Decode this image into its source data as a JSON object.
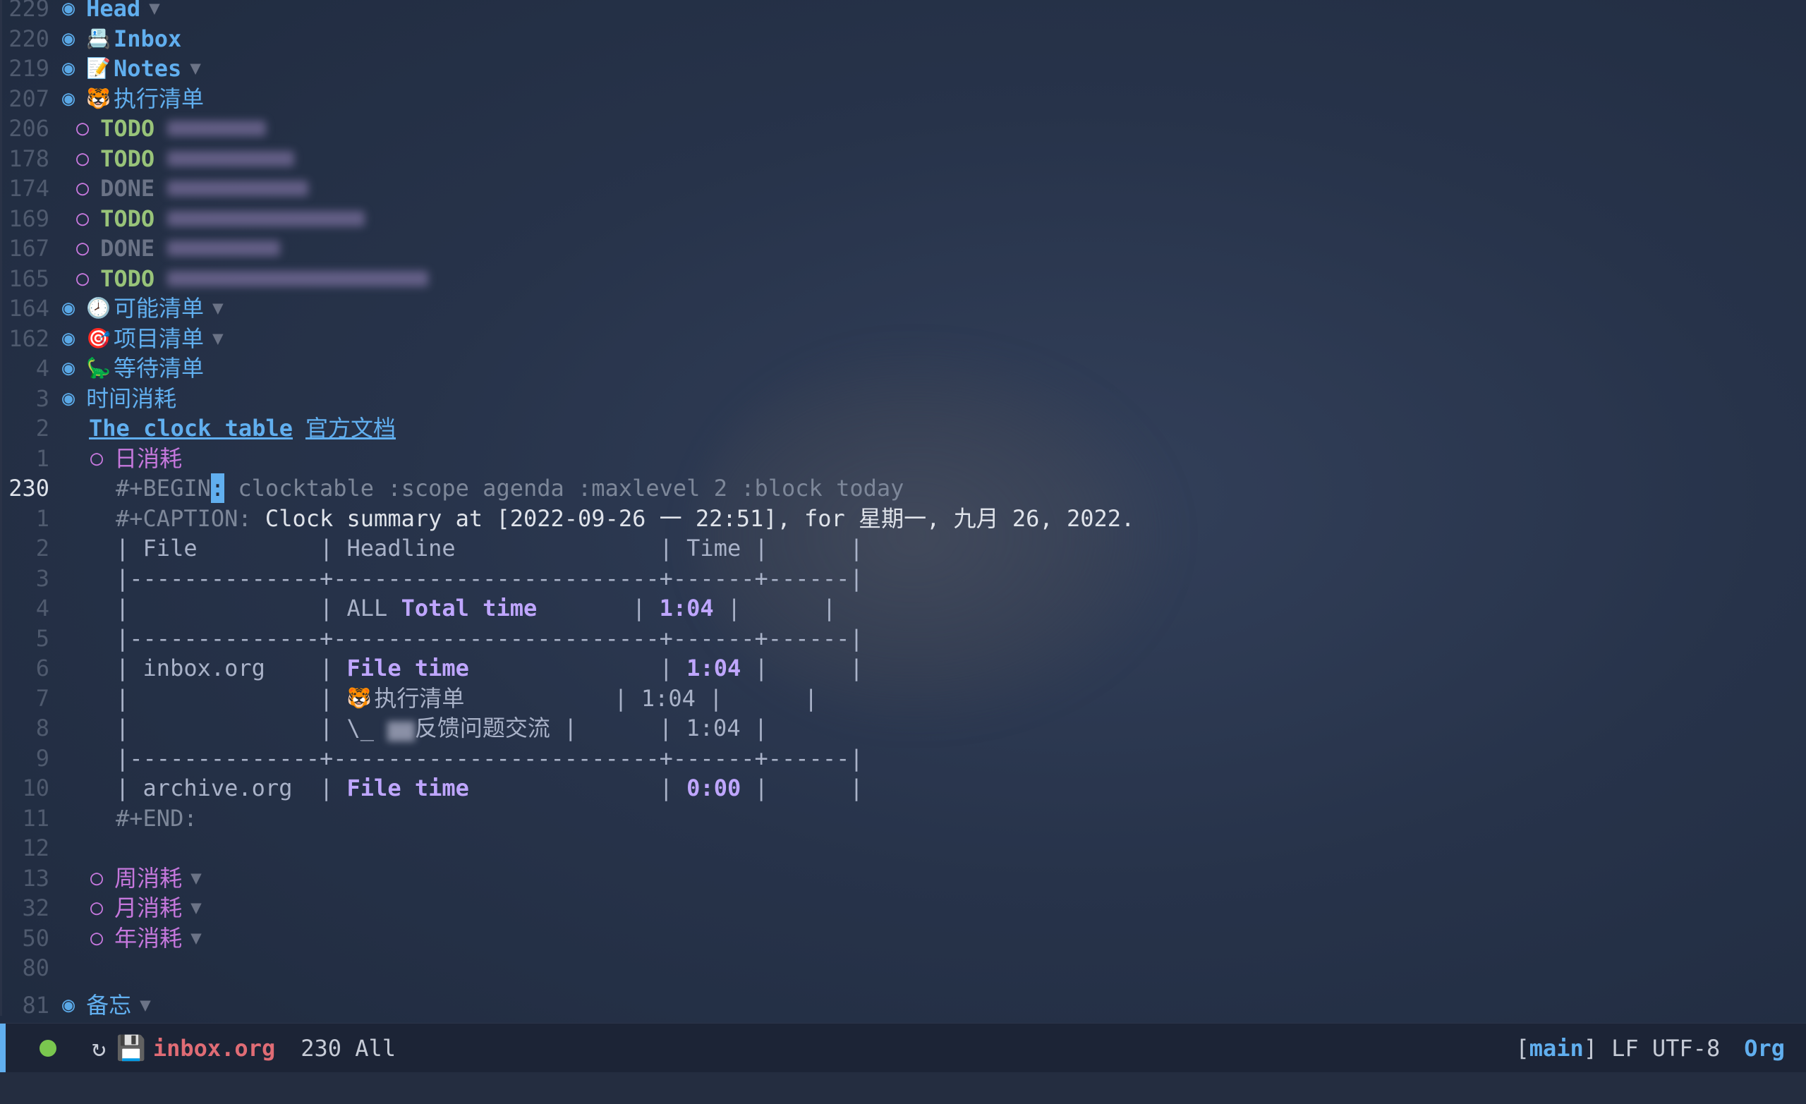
{
  "outline": [
    {
      "num": "229",
      "kind": "h1",
      "bullet": "◉",
      "label": "Head",
      "fold": "▼"
    },
    {
      "num": "220",
      "kind": "h1",
      "bullet": "◉",
      "emoji": "📇",
      "label": "Inbox"
    },
    {
      "num": "219",
      "kind": "h1",
      "bullet": "◉",
      "emoji": "📝",
      "label": "Notes",
      "fold": "▼"
    },
    {
      "num": "207",
      "kind": "h1",
      "bullet": "◉",
      "emoji": "🐯",
      "label": "执行清单"
    },
    {
      "num": "206",
      "kind": "todo",
      "bullet": "○",
      "keyword": "TODO"
    },
    {
      "num": "178",
      "kind": "todo",
      "bullet": "○",
      "keyword": "TODO"
    },
    {
      "num": "174",
      "kind": "done",
      "bullet": "○",
      "keyword": "DONE"
    },
    {
      "num": "169",
      "kind": "todo",
      "bullet": "○",
      "keyword": "TODO"
    },
    {
      "num": "167",
      "kind": "done",
      "bullet": "○",
      "keyword": "DONE"
    },
    {
      "num": "165",
      "kind": "todo",
      "bullet": "○",
      "keyword": "TODO"
    },
    {
      "num": "164",
      "kind": "h1",
      "bullet": "◉",
      "emoji": "🕗",
      "label": "可能清单",
      "fold": "▼"
    },
    {
      "num": "162",
      "kind": "h1",
      "bullet": "◉",
      "emoji": "🎯",
      "label": "项目清单",
      "fold": "▼"
    },
    {
      "num": "4",
      "kind": "h1",
      "bullet": "◉",
      "emoji": "🦕",
      "label": "等待清单"
    },
    {
      "num": "3",
      "kind": "h1",
      "bullet": "◉",
      "label": "时间消耗"
    }
  ],
  "link": {
    "num": "2",
    "text": "The clock table",
    "suffix": "官方文档"
  },
  "day_heading": {
    "num": "1",
    "bullet": "○",
    "label": "日消耗"
  },
  "begin_line": {
    "num": "230",
    "prefix": "#+BEGIN",
    "cursor": ":",
    "rest": " clocktable :scope agenda :maxlevel 2 :block today"
  },
  "caption_line": {
    "num": "1",
    "prefix": "#+CAPTION:",
    "text": " Clock summary at [2022-09-26 一 22:51], for 星期一, 九月 26, 2022."
  },
  "table_lines": [
    {
      "num": "2",
      "text": "| File         | Headline               | Time |      |"
    },
    {
      "num": "3",
      "text": "|--------------+------------------------+------+------|"
    },
    {
      "num": "4",
      "a": "|              | ",
      "b": "ALL ",
      "bold": "Total time",
      "c": "       | ",
      "val": "1:04",
      "d": " |      |"
    },
    {
      "num": "5",
      "text": "|--------------+------------------------+------+------|"
    },
    {
      "num": "6",
      "a": "| inbox.org    | ",
      "bold": "File time",
      "c": "              | ",
      "val": "1:04",
      "d": " |      |"
    },
    {
      "num": "7",
      "a": "|              | ",
      "emoji": "🐯",
      "plain": "执行清单",
      "c": "           | ",
      "pval": "1:04",
      "d": " |      |"
    },
    {
      "num": "8",
      "a": "|              | \\_ ",
      "blurred": "▆▆",
      "plain": "反馈问题交流",
      "c": " |      | ",
      "pval": "1:04",
      "d": " |"
    },
    {
      "num": "9",
      "text": "|--------------+------------------------+------+------|"
    },
    {
      "num": "10",
      "a": "| archive.org  | ",
      "bold": "File time",
      "c": "              | ",
      "val": "0:00",
      "d": " |      |"
    }
  ],
  "end_line": {
    "num": "11",
    "text": "#+END:"
  },
  "blank_12": {
    "num": "12"
  },
  "sub_headings": [
    {
      "num": "13",
      "bullet": "○",
      "label": "周消耗",
      "fold": "▼"
    },
    {
      "num": "32",
      "bullet": "○",
      "label": "月消耗",
      "fold": "▼"
    },
    {
      "num": "50",
      "bullet": "○",
      "label": "年消耗",
      "fold": "▼"
    }
  ],
  "blank_80": {
    "num": "80"
  },
  "memo": {
    "num": "81",
    "bullet": "◉",
    "label": "备忘",
    "fold": "▼"
  },
  "modeline": {
    "spinner_icon": "↻",
    "save_icon": "💾",
    "filename": "inbox.org",
    "position": "230 All",
    "branch": "main",
    "encoding": "LF UTF-8",
    "mode": "Org"
  },
  "colors": {
    "background": "#27334a",
    "heading": "#61afef",
    "todo": "#98c379",
    "done": "#6b7386",
    "subheading": "#c678dd",
    "filename": "#e06c75",
    "status_dot": "#7ac74f"
  }
}
